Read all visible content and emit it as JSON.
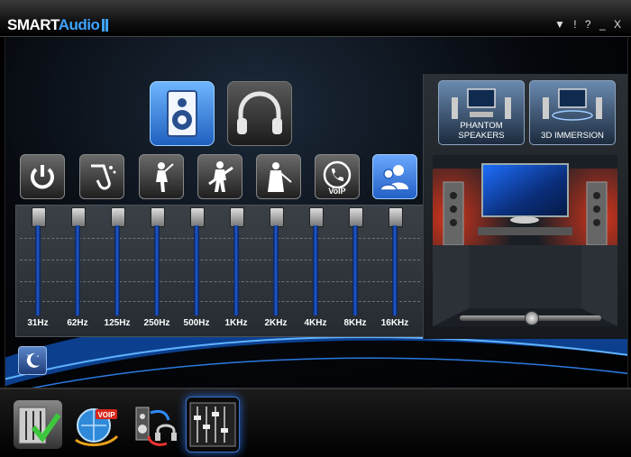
{
  "app": {
    "brand_part1": "SMART",
    "brand_part2": "Audio",
    "window_controls": [
      "▼",
      "!",
      "?",
      "_",
      "X"
    ]
  },
  "top_devices": [
    {
      "name": "speaker",
      "icon": "speaker-icon",
      "selected": true
    },
    {
      "name": "headphones",
      "icon": "headphone-icon",
      "selected": false
    }
  ],
  "presets": [
    {
      "icon": "power-icon",
      "selected": false
    },
    {
      "icon": "saxophone-icon",
      "selected": false
    },
    {
      "icon": "singer-icon",
      "selected": false
    },
    {
      "icon": "guitarist-icon",
      "selected": false
    },
    {
      "icon": "violinist-icon",
      "selected": false
    },
    {
      "icon": "voip-icon",
      "label": "VoIP",
      "selected": false
    },
    {
      "icon": "users-icon",
      "selected": true
    }
  ],
  "equalizer": {
    "bands": [
      {
        "label": "31Hz",
        "level": 1.0
      },
      {
        "label": "62Hz",
        "level": 1.0
      },
      {
        "label": "125Hz",
        "level": 1.0
      },
      {
        "label": "250Hz",
        "level": 1.0
      },
      {
        "label": "500Hz",
        "level": 1.0
      },
      {
        "label": "1KHz",
        "level": 1.0
      },
      {
        "label": "2KHz",
        "level": 1.0
      },
      {
        "label": "4KHz",
        "level": 1.0
      },
      {
        "label": "8KHz",
        "level": 1.0
      },
      {
        "label": "16KHz",
        "level": 1.0
      }
    ]
  },
  "night_mode": {
    "icon": "moon-icon"
  },
  "effects": {
    "phantom_label": "PHANTOM SPEAKERS",
    "immersion_label": "3D IMMERSION",
    "balance_level": 0.5
  },
  "bottom_tabs": [
    {
      "icon": "mixer-check-icon"
    },
    {
      "icon": "voip-globe-icon",
      "badge": "VOIP"
    },
    {
      "icon": "speaker-headphone-switch-icon"
    },
    {
      "icon": "equalizer-icon",
      "selected": true
    }
  ],
  "colors": {
    "accent": "#3da3ff",
    "slider_fill": "#1f5bd6"
  }
}
